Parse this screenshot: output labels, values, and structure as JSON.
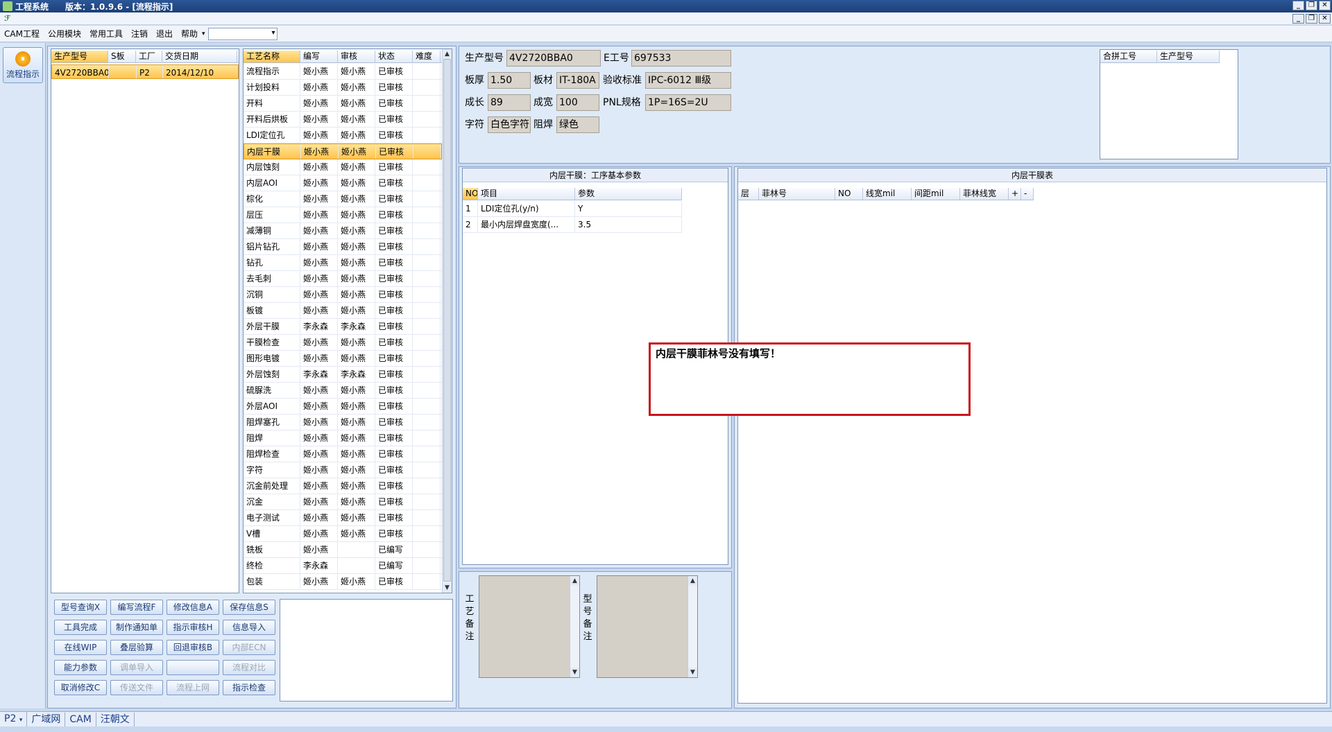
{
  "titlebar": {
    "app": "工程系统",
    "version": "版本：1.0.9.6 - [流程指示]"
  },
  "menu": [
    "CAM工程",
    "公用模块",
    "常用工具",
    "注销",
    "退出",
    "帮助"
  ],
  "sidebar": {
    "flow_button": "流程指示"
  },
  "jobs": {
    "headers": [
      "生产型号",
      "S板",
      "工厂",
      "交货日期"
    ],
    "rows": [
      [
        "4V2720BBA0",
        "",
        "P2",
        "2014/12/10"
      ]
    ]
  },
  "process": {
    "headers": [
      "工艺名称",
      "编写",
      "审核",
      "状态",
      "难度"
    ],
    "rows": [
      [
        "流程指示",
        "姬小燕",
        "姬小燕",
        "已审核",
        ""
      ],
      [
        "计划投料",
        "姬小燕",
        "姬小燕",
        "已审核",
        ""
      ],
      [
        "开料",
        "姬小燕",
        "姬小燕",
        "已审核",
        ""
      ],
      [
        "开料后烘板",
        "姬小燕",
        "姬小燕",
        "已审核",
        ""
      ],
      [
        "LDI定位孔",
        "姬小燕",
        "姬小燕",
        "已审核",
        ""
      ],
      [
        "内层干膜",
        "姬小燕",
        "姬小燕",
        "已审核",
        ""
      ],
      [
        "内层蚀刻",
        "姬小燕",
        "姬小燕",
        "已审核",
        ""
      ],
      [
        "内层AOI",
        "姬小燕",
        "姬小燕",
        "已审核",
        ""
      ],
      [
        "棕化",
        "姬小燕",
        "姬小燕",
        "已审核",
        ""
      ],
      [
        "层压",
        "姬小燕",
        "姬小燕",
        "已审核",
        ""
      ],
      [
        "减薄铜",
        "姬小燕",
        "姬小燕",
        "已审核",
        ""
      ],
      [
        "铝片钻孔",
        "姬小燕",
        "姬小燕",
        "已审核",
        ""
      ],
      [
        "钻孔",
        "姬小燕",
        "姬小燕",
        "已审核",
        ""
      ],
      [
        "去毛刺",
        "姬小燕",
        "姬小燕",
        "已审核",
        ""
      ],
      [
        "沉铜",
        "姬小燕",
        "姬小燕",
        "已审核",
        ""
      ],
      [
        "板镀",
        "姬小燕",
        "姬小燕",
        "已审核",
        ""
      ],
      [
        "外层干膜",
        "李永森",
        "李永森",
        "已审核",
        ""
      ],
      [
        "干膜检查",
        "姬小燕",
        "姬小燕",
        "已审核",
        ""
      ],
      [
        "图形电镀",
        "姬小燕",
        "姬小燕",
        "已审核",
        ""
      ],
      [
        "外层蚀刻",
        "李永森",
        "李永森",
        "已审核",
        ""
      ],
      [
        "硫脲洗",
        "姬小燕",
        "姬小燕",
        "已审核",
        ""
      ],
      [
        "外层AOI",
        "姬小燕",
        "姬小燕",
        "已审核",
        ""
      ],
      [
        "阻焊塞孔",
        "姬小燕",
        "姬小燕",
        "已审核",
        ""
      ],
      [
        "阻焊",
        "姬小燕",
        "姬小燕",
        "已审核",
        ""
      ],
      [
        "阻焊检查",
        "姬小燕",
        "姬小燕",
        "已审核",
        ""
      ],
      [
        "字符",
        "姬小燕",
        "姬小燕",
        "已审核",
        ""
      ],
      [
        "沉金前处理",
        "姬小燕",
        "姬小燕",
        "已审核",
        ""
      ],
      [
        "沉金",
        "姬小燕",
        "姬小燕",
        "已审核",
        ""
      ],
      [
        "电子测试",
        "姬小燕",
        "姬小燕",
        "已审核",
        ""
      ],
      [
        "V槽",
        "姬小燕",
        "姬小燕",
        "已审核",
        ""
      ],
      [
        "铣板",
        "姬小燕",
        "",
        "已编写",
        ""
      ],
      [
        "终检",
        "李永森",
        "",
        "已编写",
        ""
      ],
      [
        "包装",
        "姬小燕",
        "姬小燕",
        "已审核",
        ""
      ]
    ],
    "selected_index": 5
  },
  "commands": [
    [
      "型号查询X",
      "编写流程F",
      "修改信息A",
      "保存信息S"
    ],
    [
      "工具完成",
      "制作通知单",
      "指示审核H",
      "信息导入"
    ],
    [
      "在线WIP",
      "叠层验算",
      "回退审核B",
      "内部ECN"
    ],
    [
      "能力参数",
      "调单导入",
      "",
      "流程对比"
    ],
    [
      "取消修改C",
      "传送文件",
      "流程上网",
      "指示检查"
    ]
  ],
  "info": {
    "model_label": "生产型号",
    "model": "4V2720BBA0",
    "eno_label": "E工号",
    "eno": "697533",
    "thick_label": "板厚",
    "thick": "1.50",
    "material_label": "板材",
    "material": "IT-180A",
    "standard_label": "验收标准",
    "standard": "IPC-6012 Ⅲ级",
    "len_label": "成长",
    "len": "89",
    "wid_label": "成宽",
    "wid": "100",
    "pnl_label": "PNL规格",
    "pnl": "1P=16S=2U",
    "char_label": "字符",
    "char": "白色字符",
    "mask_label": "阻焊",
    "mask": "绿色"
  },
  "merge": {
    "headers": [
      "合拼工号",
      "生产型号"
    ]
  },
  "params": {
    "title": "内层干膜：工序基本参数",
    "headers": [
      "NO",
      "项目",
      "参数"
    ],
    "rows": [
      [
        "1",
        "LDI定位孔(y/n)",
        "Y"
      ],
      [
        "2",
        "最小内层焊盘宽度(...",
        "3.5"
      ]
    ]
  },
  "table": {
    "title": "内层干膜表",
    "headers": [
      "层",
      "菲林号",
      "NO",
      "线宽mil",
      "间距mil",
      "菲林线宽",
      "+",
      "-"
    ]
  },
  "notes": {
    "process_label": "工艺备注",
    "model_label": "型号备注"
  },
  "message": "内层干膜菲林号没有填写！",
  "status": [
    "P2",
    "广域网",
    "CAM",
    "汪朝文"
  ]
}
